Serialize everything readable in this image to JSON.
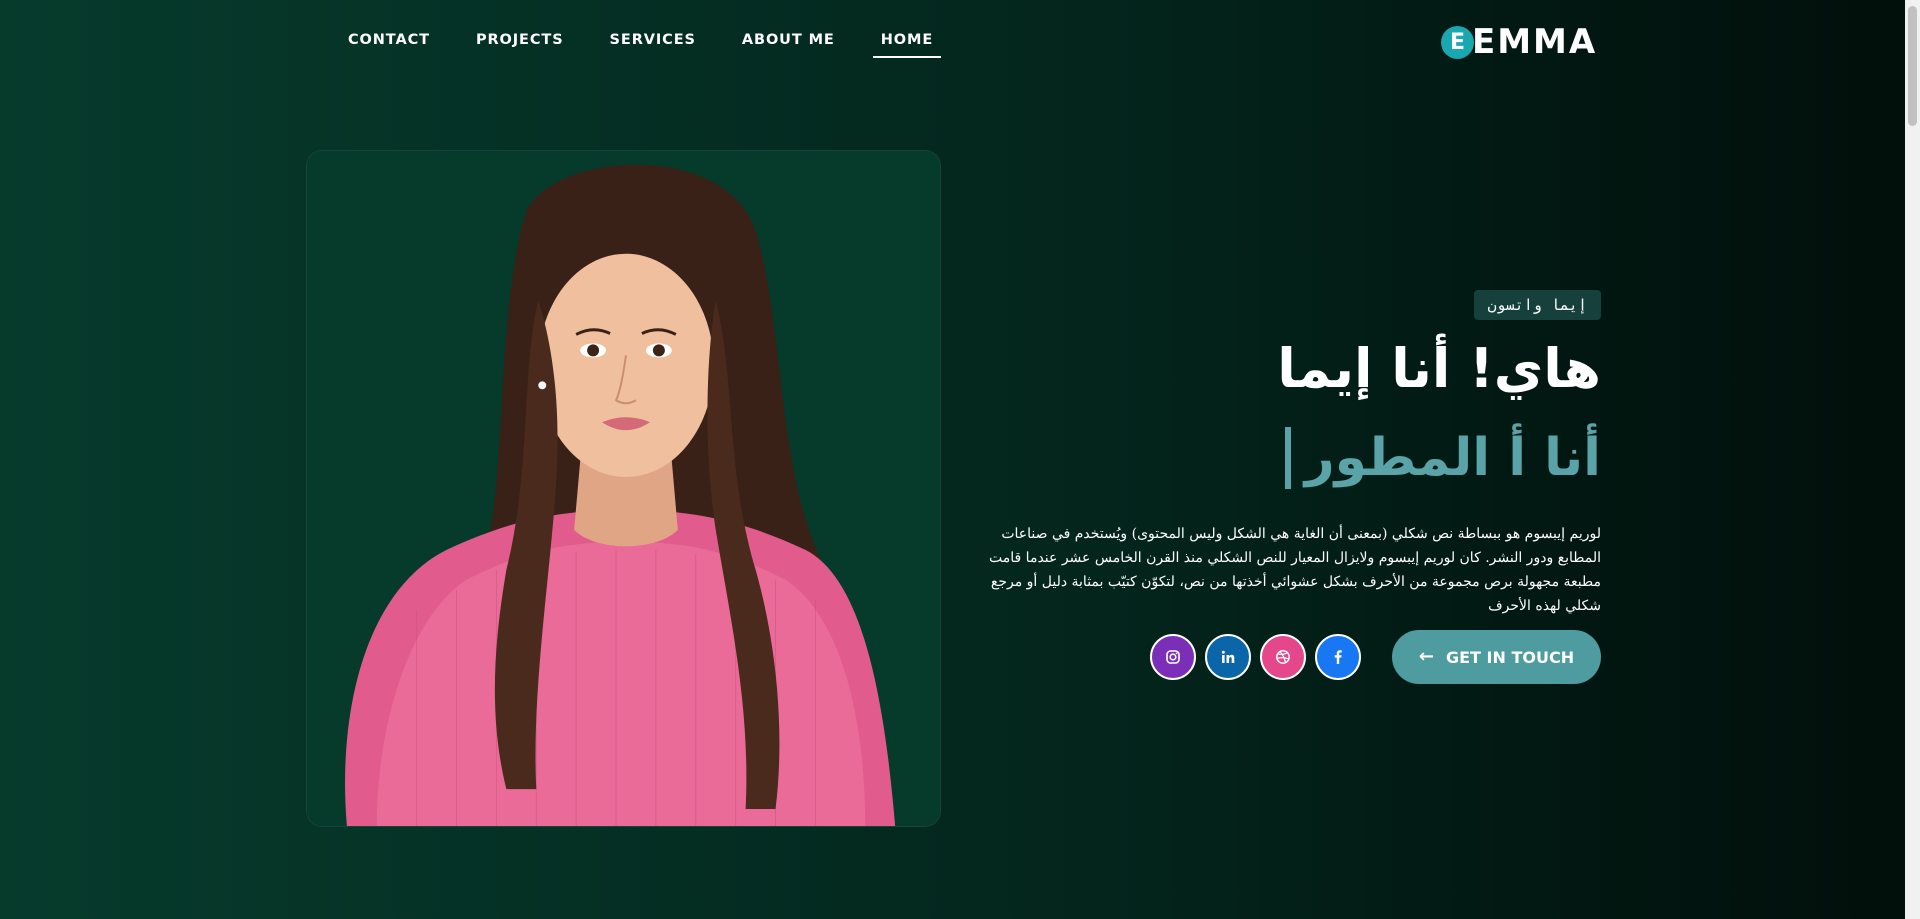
{
  "nav": {
    "links": [
      {
        "label": "CONTACT",
        "active": false
      },
      {
        "label": "PROJECTS",
        "active": false
      },
      {
        "label": "SERVICES",
        "active": false
      },
      {
        "label": "ABOUT ME",
        "active": false
      },
      {
        "label": "HOME",
        "active": true
      }
    ]
  },
  "logo": {
    "badge": "E",
    "text": "EMMA",
    "badge_color": "#19a7b0"
  },
  "hero": {
    "name_tag": "إيما واتسون",
    "title": "هاي! أنا إيما",
    "role": "أنا أ المطور",
    "description": "لوريم إيبسوم هو ببساطة نص شكلي (بمعنى أن الغاية هي الشكل وليس المحتوى) ويُستخدم في صناعات المطابع ودور النشر. كان لوريم إيبسوم ولايزال المعيار للنص الشكلي منذ القرن الخامس عشر عندما قامت مطبعة مجهولة برص مجموعة من الأحرف بشكل عشوائي أخذتها من نص، لتكوّن كتيّب بمثابة دليل أو مرجع شكلي لهذه الأحرف",
    "cta_label": "GET IN TOUCH",
    "cta_color": "#4e9ba0",
    "accent_color": "#5aa3a9"
  },
  "socials": [
    {
      "name": "instagram",
      "icon": "instagram-icon",
      "color": "#7b2fb8"
    },
    {
      "name": "linkedin",
      "icon": "linkedin-icon",
      "color": "#0a66a8"
    },
    {
      "name": "dribbble",
      "icon": "dribbble-icon",
      "color": "#e5488a"
    },
    {
      "name": "facebook",
      "icon": "facebook-icon",
      "color": "#1877f2"
    }
  ]
}
